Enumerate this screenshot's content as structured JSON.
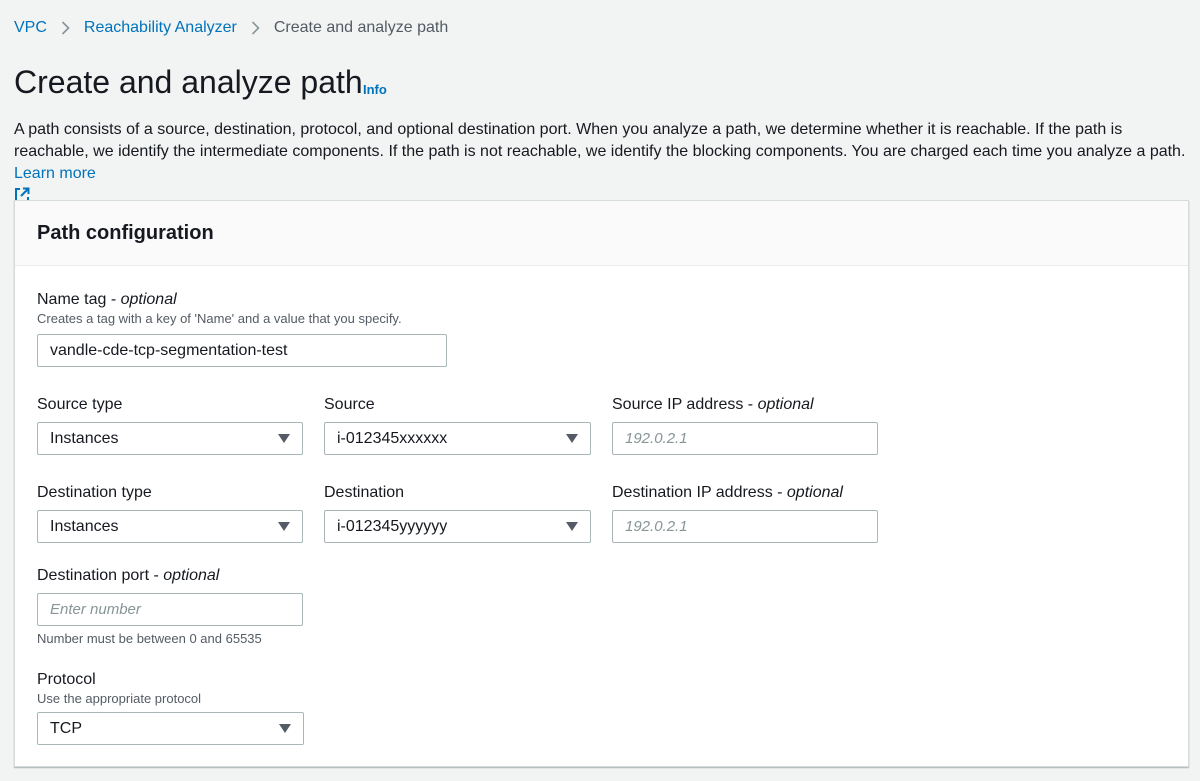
{
  "breadcrumb": {
    "items": [
      "VPC",
      "Reachability Analyzer"
    ],
    "current": "Create and analyze path"
  },
  "page": {
    "title": "Create and analyze path",
    "info": "Info",
    "description": "A path consists of a source, destination, protocol, and optional destination port. When you analyze a path, we determine whether it is reachable. If the path is reachable, we identify the intermediate components. If the path is not reachable, we identify the blocking components. You are charged each time you analyze a path.",
    "learn_more": "Learn more"
  },
  "panel": {
    "title": "Path configuration",
    "name_tag": {
      "label": "Name tag",
      "optional": "optional",
      "hint": "Creates a tag with a key of 'Name' and a value that you specify.",
      "value": "vandle-cde-tcp-segmentation-test"
    },
    "source_type": {
      "label": "Source type",
      "value": "Instances"
    },
    "source": {
      "label": "Source",
      "value": "i-012345xxxxxx"
    },
    "source_ip": {
      "label": "Source IP address",
      "optional": "optional",
      "placeholder": "192.0.2.1"
    },
    "destination_type": {
      "label": "Destination type",
      "value": "Instances"
    },
    "destination": {
      "label": "Destination",
      "value": "i-012345yyyyyy"
    },
    "destination_ip": {
      "label": "Destination IP address",
      "optional": "optional",
      "placeholder": "192.0.2.1"
    },
    "destination_port": {
      "label": "Destination port",
      "optional": "optional",
      "placeholder": "Enter number",
      "hint": "Number must be between 0 and 65535"
    },
    "protocol": {
      "label": "Protocol",
      "hint": "Use the appropriate protocol",
      "value": "TCP"
    }
  },
  "colors": {
    "link": "#0073bb",
    "background": "#f2f3f3"
  }
}
